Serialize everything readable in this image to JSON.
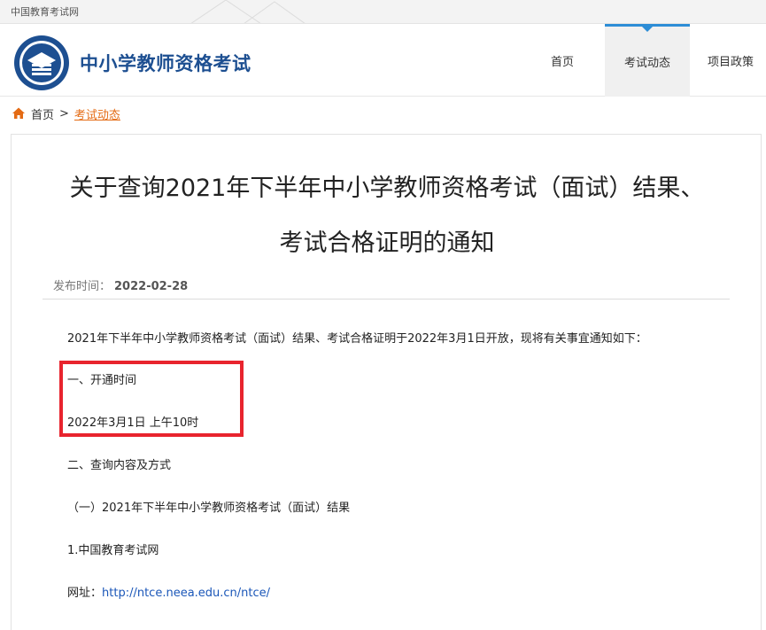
{
  "topbar": {
    "site_name": "中国教育考试网"
  },
  "header": {
    "brand_title": "中小学教师资格考试",
    "nav": [
      {
        "label": "首页"
      },
      {
        "label": "考试动态",
        "active": true
      },
      {
        "label": "项目政策"
      }
    ]
  },
  "breadcrumb": {
    "home": "首页",
    "separator": ">",
    "current": "考试动态"
  },
  "article": {
    "title_line1": "关于查询2021年下半年中小学教师资格考试（面试）结果、",
    "title_line2": "考试合格证明的通知",
    "publish_label": "发布时间：",
    "publish_date": "2022-02-28",
    "paragraphs": [
      "2021年下半年中小学教师资格考试（面试）结果、考试合格证明于2022年3月1日开放，现将有关事宜通知如下：",
      "一、开通时间",
      "2022年3月1日 上午10时",
      "二、查询内容及方式",
      "（一）2021年下半年中小学教师资格考试（面试）结果",
      "1.中国教育考试网"
    ],
    "url_label": "网址：",
    "url": "http://ntce.neea.edu.cn/ntce/"
  },
  "colors": {
    "brand_blue": "#1d4f91",
    "nav_active_accent": "#2d8dd6",
    "breadcrumb_current": "#e46b14",
    "highlight_red": "#e8242e",
    "link_blue": "#1a56b8"
  },
  "icons": {
    "home": "home-icon",
    "logo": "logo-emblem"
  }
}
